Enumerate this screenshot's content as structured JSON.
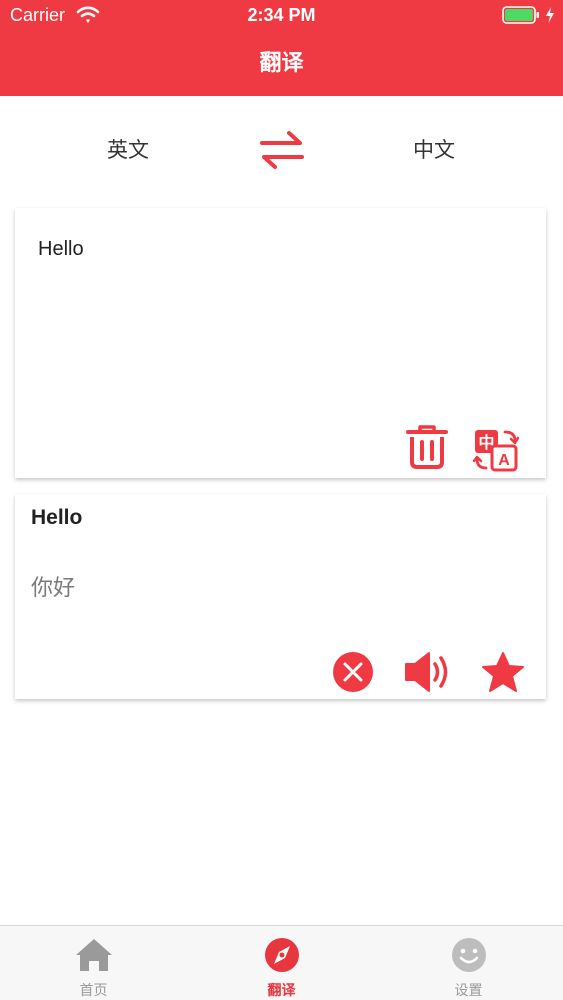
{
  "status_bar": {
    "carrier": "Carrier",
    "time": "2:34 PM"
  },
  "nav": {
    "title": "翻译"
  },
  "languages": {
    "source": "英文",
    "target": "中文"
  },
  "input": {
    "text": "Hello"
  },
  "result": {
    "source_text": "Hello",
    "translation": "你好"
  },
  "tabbar": {
    "items": [
      {
        "label": "首页",
        "icon": "home-icon",
        "active": false
      },
      {
        "label": "翻译",
        "icon": "compass-icon",
        "active": true
      },
      {
        "label": "设置",
        "icon": "smiley-icon",
        "active": false
      }
    ]
  },
  "colors": {
    "accent": "#ef3a43",
    "tab_inactive": "#9a9a9a",
    "battery": "#4cd964"
  },
  "icons": {
    "swap": "swap-arrows-icon",
    "trash": "trash-icon",
    "translate": "translate-icon",
    "clear": "close-circle-icon",
    "speaker": "speaker-icon",
    "favorite": "star-icon"
  }
}
